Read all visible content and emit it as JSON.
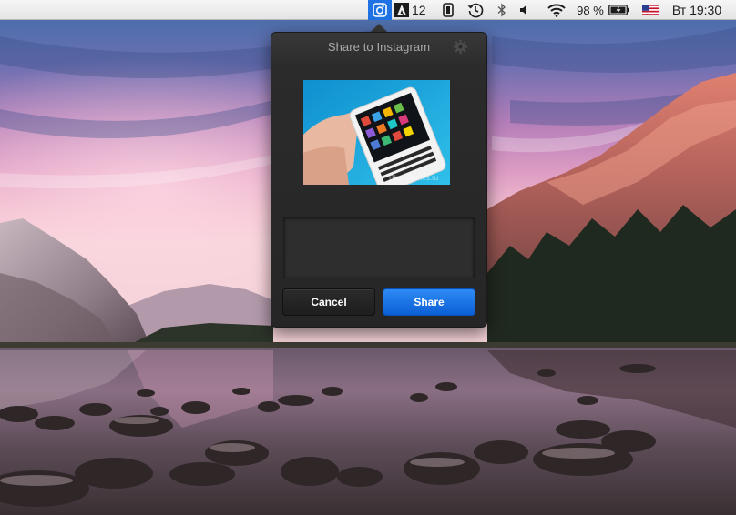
{
  "menubar": {
    "adobe_count": "12",
    "battery_percent": "98 %",
    "clock": "Вт 19:30"
  },
  "popover": {
    "title": "Share to Instagram",
    "caption_value": "",
    "cancel_label": "Cancel",
    "share_label": "Share",
    "photo_watermark": "BlackBerries.ru"
  },
  "icons": {
    "menubar": [
      "instagram-icon",
      "adobe-icon",
      "battery-status-icon",
      "time-machine-icon",
      "bluetooth-icon",
      "volume-icon",
      "wifi-icon",
      "battery-icon",
      "us-flag-icon"
    ],
    "popover": [
      "gear-icon"
    ]
  },
  "colors": {
    "share_button": "#1a6fe6",
    "menubar_active": "#1f72e3",
    "popover_bg": "#262626"
  }
}
